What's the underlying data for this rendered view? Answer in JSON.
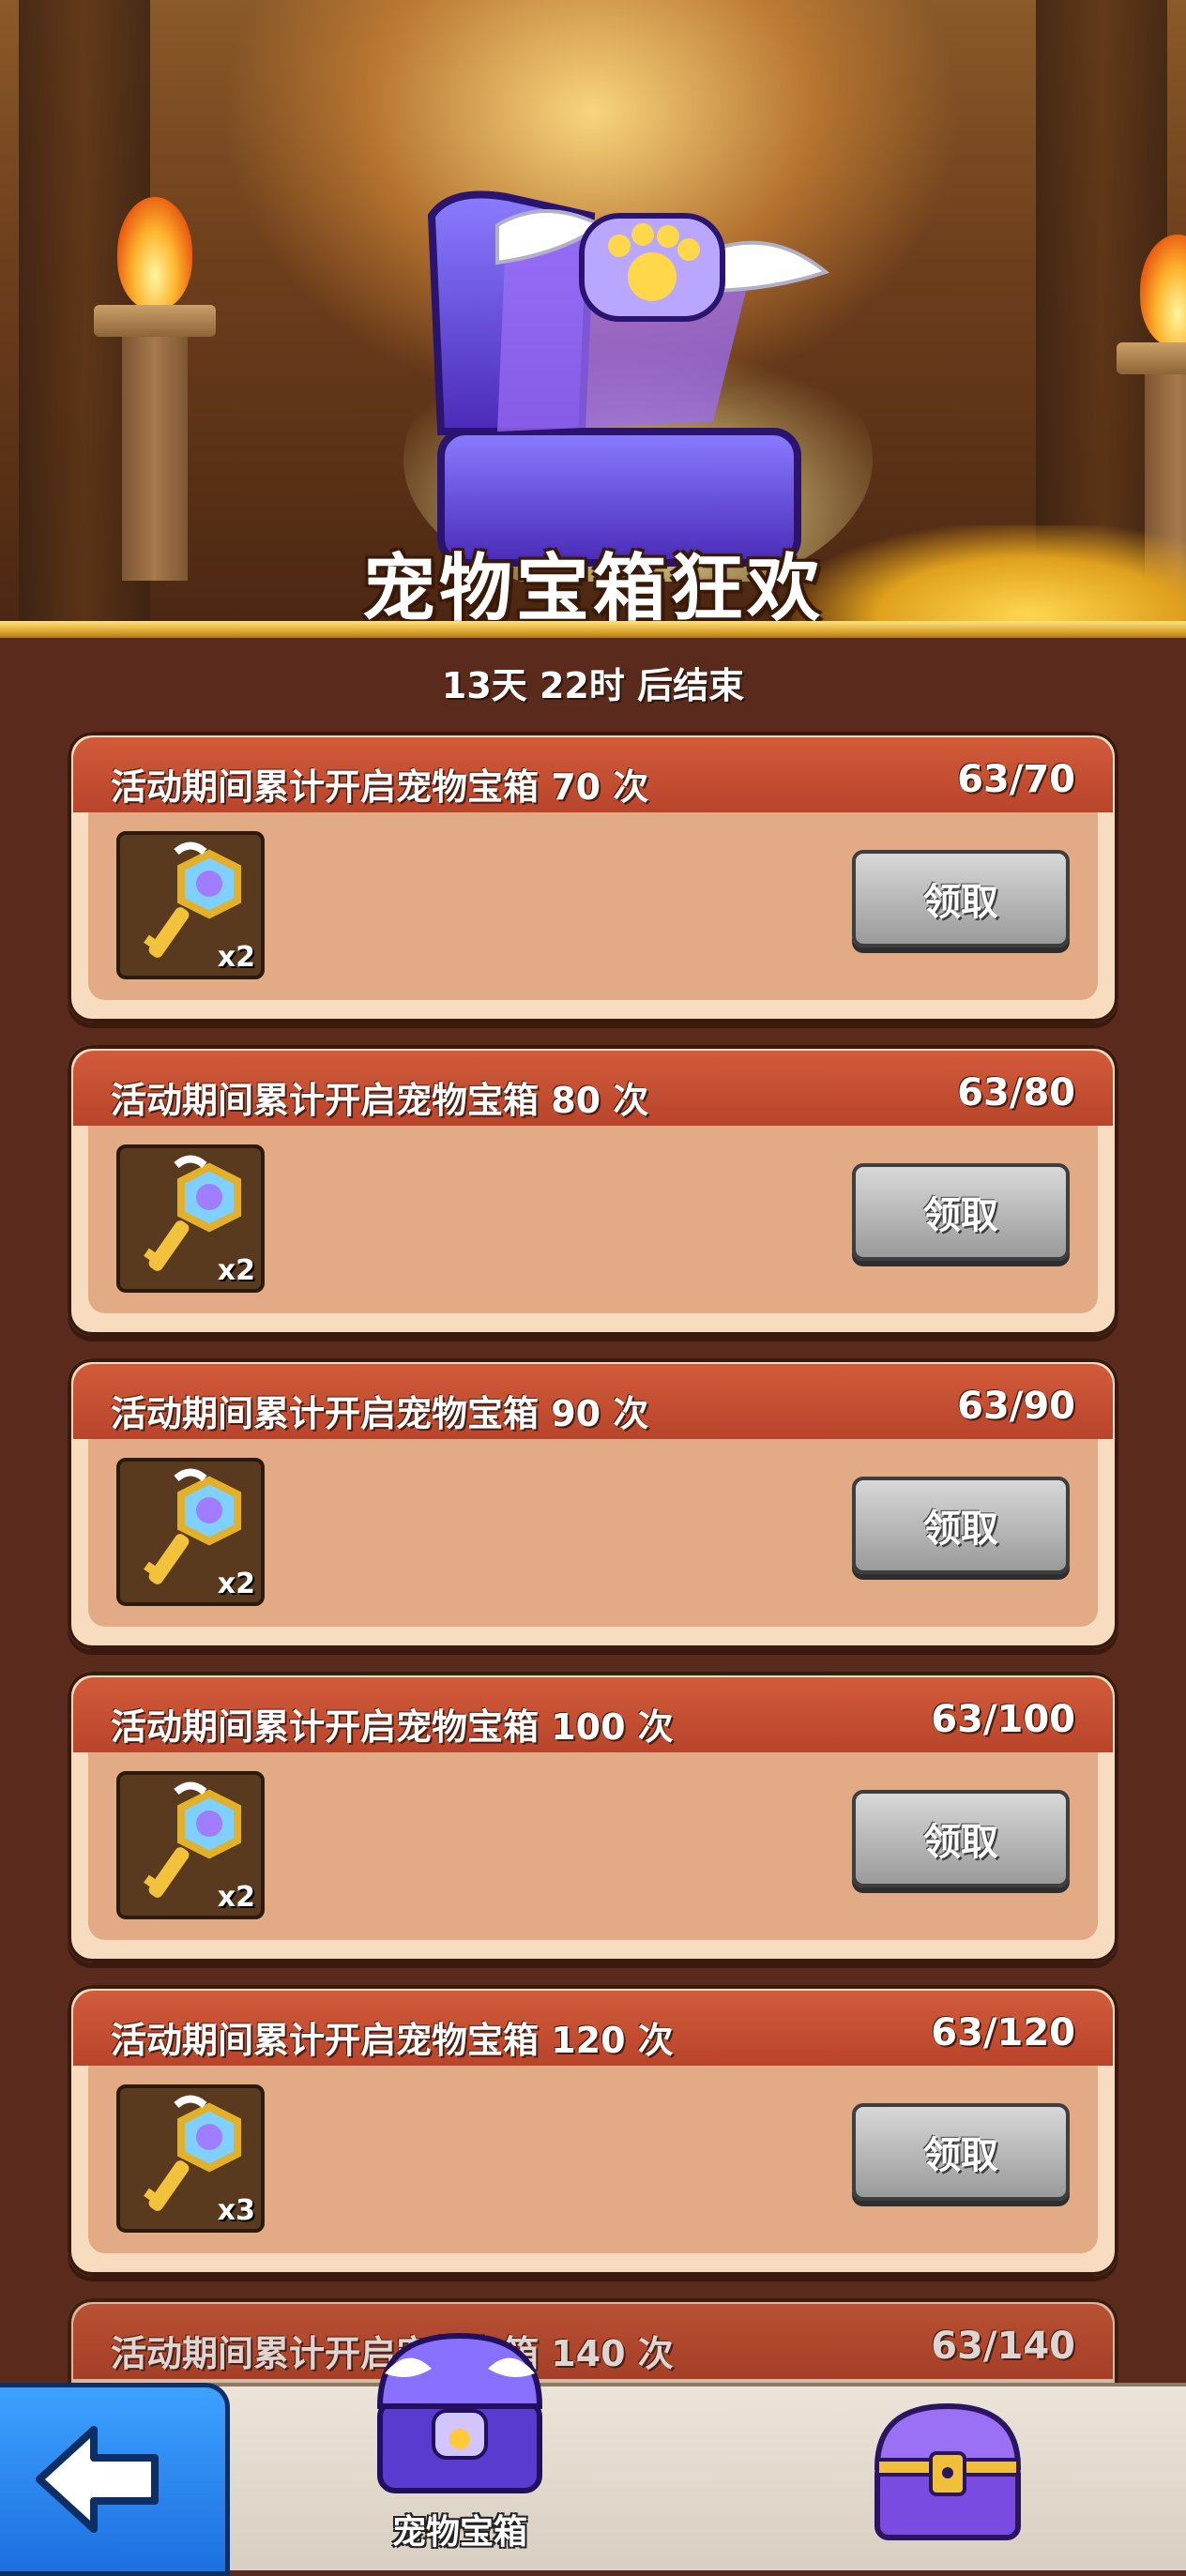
{
  "banner": {
    "title": "宠物宝箱狂欢"
  },
  "timer": {
    "text": "13天 22时 后结束"
  },
  "colors": {
    "card_header": "#c64f33",
    "card_body": "#e2ab85",
    "claim_button": "#bdbdbd",
    "back_button": "#2a8af0"
  },
  "rewards": [
    {
      "title": "活动期间累计开启宠物宝箱 70 次",
      "progress": "63/70",
      "item_icon": "pet-key-icon",
      "quantity": "x2",
      "button": "领取"
    },
    {
      "title": "活动期间累计开启宠物宝箱 80 次",
      "progress": "63/80",
      "item_icon": "pet-key-icon",
      "quantity": "x2",
      "button": "领取"
    },
    {
      "title": "活动期间累计开启宠物宝箱 90 次",
      "progress": "63/90",
      "item_icon": "pet-key-icon",
      "quantity": "x2",
      "button": "领取"
    },
    {
      "title": "活动期间累计开启宠物宝箱 100 次",
      "progress": "63/100",
      "item_icon": "pet-key-icon",
      "quantity": "x2",
      "button": "领取"
    },
    {
      "title": "活动期间累计开启宠物宝箱 120 次",
      "progress": "63/120",
      "item_icon": "pet-key-icon",
      "quantity": "x3",
      "button": "领取"
    },
    {
      "title": "活动期间累计开启宠物宝箱 140 次",
      "progress": "63/140",
      "item_icon": "pet-key-icon",
      "quantity": "",
      "button": ""
    }
  ],
  "nav": {
    "back_icon": "arrow-left-icon",
    "tabs": [
      {
        "label": "宠物宝箱",
        "icon": "pet-chest-icon"
      },
      {
        "label": "",
        "icon": "treasure-chest-icon"
      }
    ]
  }
}
